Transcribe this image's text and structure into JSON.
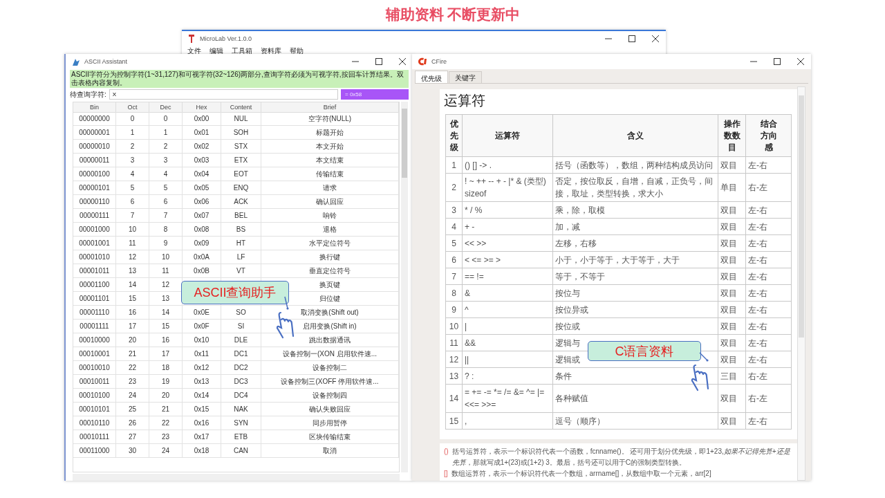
{
  "slide_title": "辅助资料 不断更新中",
  "back_window": {
    "title": "MicroLab Ver.1.0.0",
    "menu": [
      "文件",
      "编辑",
      "工具箱",
      "资料库",
      "帮助"
    ]
  },
  "ascii_window": {
    "title": "ASCII Assistant",
    "hint": "ASCII字符分为控制字符(1~31,127)和可视字符(32~126)两部分,查询字符必须为可视字符,按回车计算结果。双击表格内容复制。",
    "query_label": "待查询字符:",
    "query_value": "X",
    "result": "= 0x58",
    "columns": [
      "Bin",
      "Oct",
      "Dec",
      "Hex",
      "Content",
      "Brief"
    ],
    "rows": [
      [
        "00000000",
        "0",
        "0",
        "0x00",
        "NUL",
        "空字符(NULL)"
      ],
      [
        "00000001",
        "1",
        "1",
        "0x01",
        "SOH",
        "标题开始"
      ],
      [
        "00000010",
        "2",
        "2",
        "0x02",
        "STX",
        "本文开始"
      ],
      [
        "00000011",
        "3",
        "3",
        "0x03",
        "ETX",
        "本文结束"
      ],
      [
        "00000100",
        "4",
        "4",
        "0x04",
        "EOT",
        "传输结束"
      ],
      [
        "00000101",
        "5",
        "5",
        "0x05",
        "ENQ",
        "请求"
      ],
      [
        "00000110",
        "6",
        "6",
        "0x06",
        "ACK",
        "确认回应"
      ],
      [
        "00000111",
        "7",
        "7",
        "0x07",
        "BEL",
        "响铃"
      ],
      [
        "00001000",
        "10",
        "8",
        "0x08",
        "BS",
        "退格"
      ],
      [
        "00001001",
        "11",
        "9",
        "0x09",
        "HT",
        "水平定位符号"
      ],
      [
        "00001010",
        "12",
        "10",
        "0x0A",
        "LF",
        "换行键"
      ],
      [
        "00001011",
        "13",
        "11",
        "0x0B",
        "VT",
        "垂直定位符号"
      ],
      [
        "00001100",
        "14",
        "12",
        null,
        null,
        "换页键"
      ],
      [
        "00001101",
        "15",
        "13",
        null,
        null,
        "归位键"
      ],
      [
        "00001110",
        "16",
        "14",
        "0x0E",
        "SO",
        "取消变换(Shift out)"
      ],
      [
        "00001111",
        "17",
        "15",
        "0x0F",
        "SI",
        "启用变换(Shift in)"
      ],
      [
        "00010000",
        "20",
        "16",
        "0x10",
        "DLE",
        "跳出数据通讯"
      ],
      [
        "00010001",
        "21",
        "17",
        "0x11",
        "DC1",
        "设备控制一(XON 启用软件速..."
      ],
      [
        "00010010",
        "22",
        "18",
        "0x12",
        "DC2",
        "设备控制二"
      ],
      [
        "00010011",
        "23",
        "19",
        "0x13",
        "DC3",
        "设备控制三(XOFF 停用软件速..."
      ],
      [
        "00010100",
        "24",
        "20",
        "0x14",
        "DC4",
        "设备控制四"
      ],
      [
        "00010101",
        "25",
        "21",
        "0x15",
        "NAK",
        "确认失败回应"
      ],
      [
        "00010110",
        "26",
        "22",
        "0x16",
        "SYN",
        "同步用暂停"
      ],
      [
        "00010111",
        "27",
        "23",
        "0x17",
        "ETB",
        "区块传输结束"
      ],
      [
        "00011000",
        "30",
        "24",
        "0x18",
        "CAN",
        "取消"
      ]
    ]
  },
  "cfire_window": {
    "title": "CFire",
    "tabs": [
      {
        "label": "优先级",
        "selected": true
      },
      {
        "label": "关键字",
        "selected": false
      }
    ],
    "heading": "运算符",
    "columns": [
      "优先级",
      "运算符",
      "含义",
      "操作数数目",
      "结合方向感"
    ],
    "rows": [
      [
        "1",
        "() [] -> .",
        "括号（函数等），数组，两种结构成员访问",
        "双目",
        "左-右"
      ],
      [
        "2",
        "! ~ ++ -- + - |* & (类型) sizeof",
        "否定，按位取反，自增，自减，正负号，间接，取址，类型转换，求大小",
        "单目",
        "右-左"
      ],
      [
        "3",
        "* / %",
        "乘，除，取模",
        "双目",
        "左-右"
      ],
      [
        "4",
        "+ -",
        "加，减",
        "双目",
        "左-右"
      ],
      [
        "5",
        "<< >>",
        "左移，右移",
        "双目",
        "左-右"
      ],
      [
        "6",
        "< <= >= >",
        "小于，小于等于，大于等于，大于",
        "双目",
        "左-右"
      ],
      [
        "7",
        "== !=",
        "等于，不等于",
        "双目",
        "左-右"
      ],
      [
        "8",
        "&",
        "按位与",
        "双目",
        "左-右"
      ],
      [
        "9",
        "^",
        "按位异或",
        "双目",
        "左-右"
      ],
      [
        "10",
        "|",
        "按位或",
        "双目",
        "左-右"
      ],
      [
        "11",
        "&&",
        "逻辑与",
        "双目",
        "左-右"
      ],
      [
        "12",
        "||",
        "逻辑或",
        "双目",
        "左-右"
      ],
      [
        "13",
        "? :",
        "条件",
        "三目",
        "右-左"
      ],
      [
        "14",
        "= += -= *= /= &= ^= |= <<= >>=",
        "各种赋值",
        "双目",
        "右-左"
      ],
      [
        "15",
        ",",
        "逗号（顺序）",
        "双目",
        "左-右"
      ]
    ],
    "notes": [
      {
        "mark": "()",
        "text": "括号运算符，表示一个标识符代表一个函数，fcnname()。 还可用于划分优先级，即1+23,*如果不记得先算+还是先算*，那就写成1+(23)或(1+2) 3。最后，括号还可以用于C的强制类型转换。"
      },
      {
        "mark": "[]",
        "text": "数组运算符，表示一个标识符代表一个数组，arrname[]，从数组中取一个元素，arr[2]"
      }
    ]
  },
  "callouts": [
    {
      "text": "ASCII查询助手"
    },
    {
      "text": "C语言资料"
    }
  ]
}
